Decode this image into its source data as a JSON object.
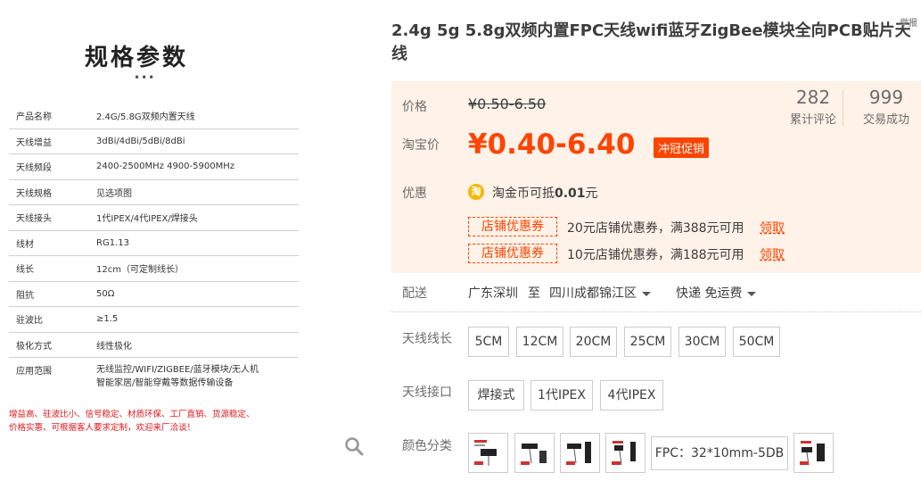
{
  "spec": {
    "title": "规格参数",
    "dots": "•••",
    "rows": [
      {
        "k": "产品名称",
        "v": "2.4G/5.8G双频内置天线"
      },
      {
        "k": "天线增益",
        "v": "3dBi/4dBi/5dBi/8dBi"
      },
      {
        "k": "天线频段",
        "v": "2400-2500MHz 4900-5900MHz"
      },
      {
        "k": "天线规格",
        "v": "见选项图"
      },
      {
        "k": "天线接头",
        "v": "1代IPEX/4代IPEX/焊接头"
      },
      {
        "k": "线材",
        "v": "RG1.13"
      },
      {
        "k": "线长",
        "v": "12cm（可定制线长）"
      },
      {
        "k": "阻抗",
        "v": "50Ω"
      },
      {
        "k": "驻波比",
        "v": "≥1.5"
      },
      {
        "k": "极化方式",
        "v": "线性极化"
      }
    ],
    "app_key": "应用范围",
    "app_line1": "无线监控/WIFI/ZIGBEE/蓝牙模块/无人机",
    "app_line2": "智能家居/智能穿戴等数据传输设备",
    "red_line1": "增益高、驻波比小、信号稳定、材质环保、工厂直销、货源稳定、",
    "red_line2": "价格实惠、可根据客人要求定制，欢迎来厂洽谈！"
  },
  "product": {
    "title": "2.4g 5g 5.8g双频内置FPC天线wifi蓝牙ZigBee模块全向PCB贴片天线",
    "corner": "举报"
  },
  "price": {
    "label": "价格",
    "original": "¥0.50-6.50",
    "tb_label": "淘宝价",
    "current": "¥0.40-6.40",
    "promo_tag": "冲冠促销",
    "reviews_count": "282",
    "reviews_label": "累计评论",
    "sales_count": "999",
    "sales_label": "交易成功"
  },
  "promo": {
    "label": "优惠",
    "coin_icon": "淘",
    "coin_text_a": "淘金币可抵",
    "coin_text_b": "0.01",
    "coin_text_c": "元",
    "shop_tag": "店铺优惠券",
    "coupons": [
      {
        "text": "20元店铺优惠券，满388元可用",
        "claim": "领取"
      },
      {
        "text": "10元店铺优惠券，满188元可用",
        "claim": "领取"
      }
    ]
  },
  "shipping": {
    "label": "配送",
    "from": "广东深圳",
    "to_word": "至",
    "to": "四川成都锦江区",
    "method": "快递 免运费"
  },
  "options": {
    "length_label": "天线线长",
    "lengths": [
      "5CM",
      "12CM",
      "20CM",
      "25CM",
      "30CM",
      "50CM"
    ],
    "connector_label": "天线接口",
    "connectors": [
      "焊接式",
      "1代IPEX",
      "4代IPEX"
    ],
    "color_label": "颜色分类",
    "color_text_option": "FPC：32*10mm-5DB"
  },
  "colors": {
    "accent": "#ff4400",
    "price_bg": "#fff2e8"
  }
}
